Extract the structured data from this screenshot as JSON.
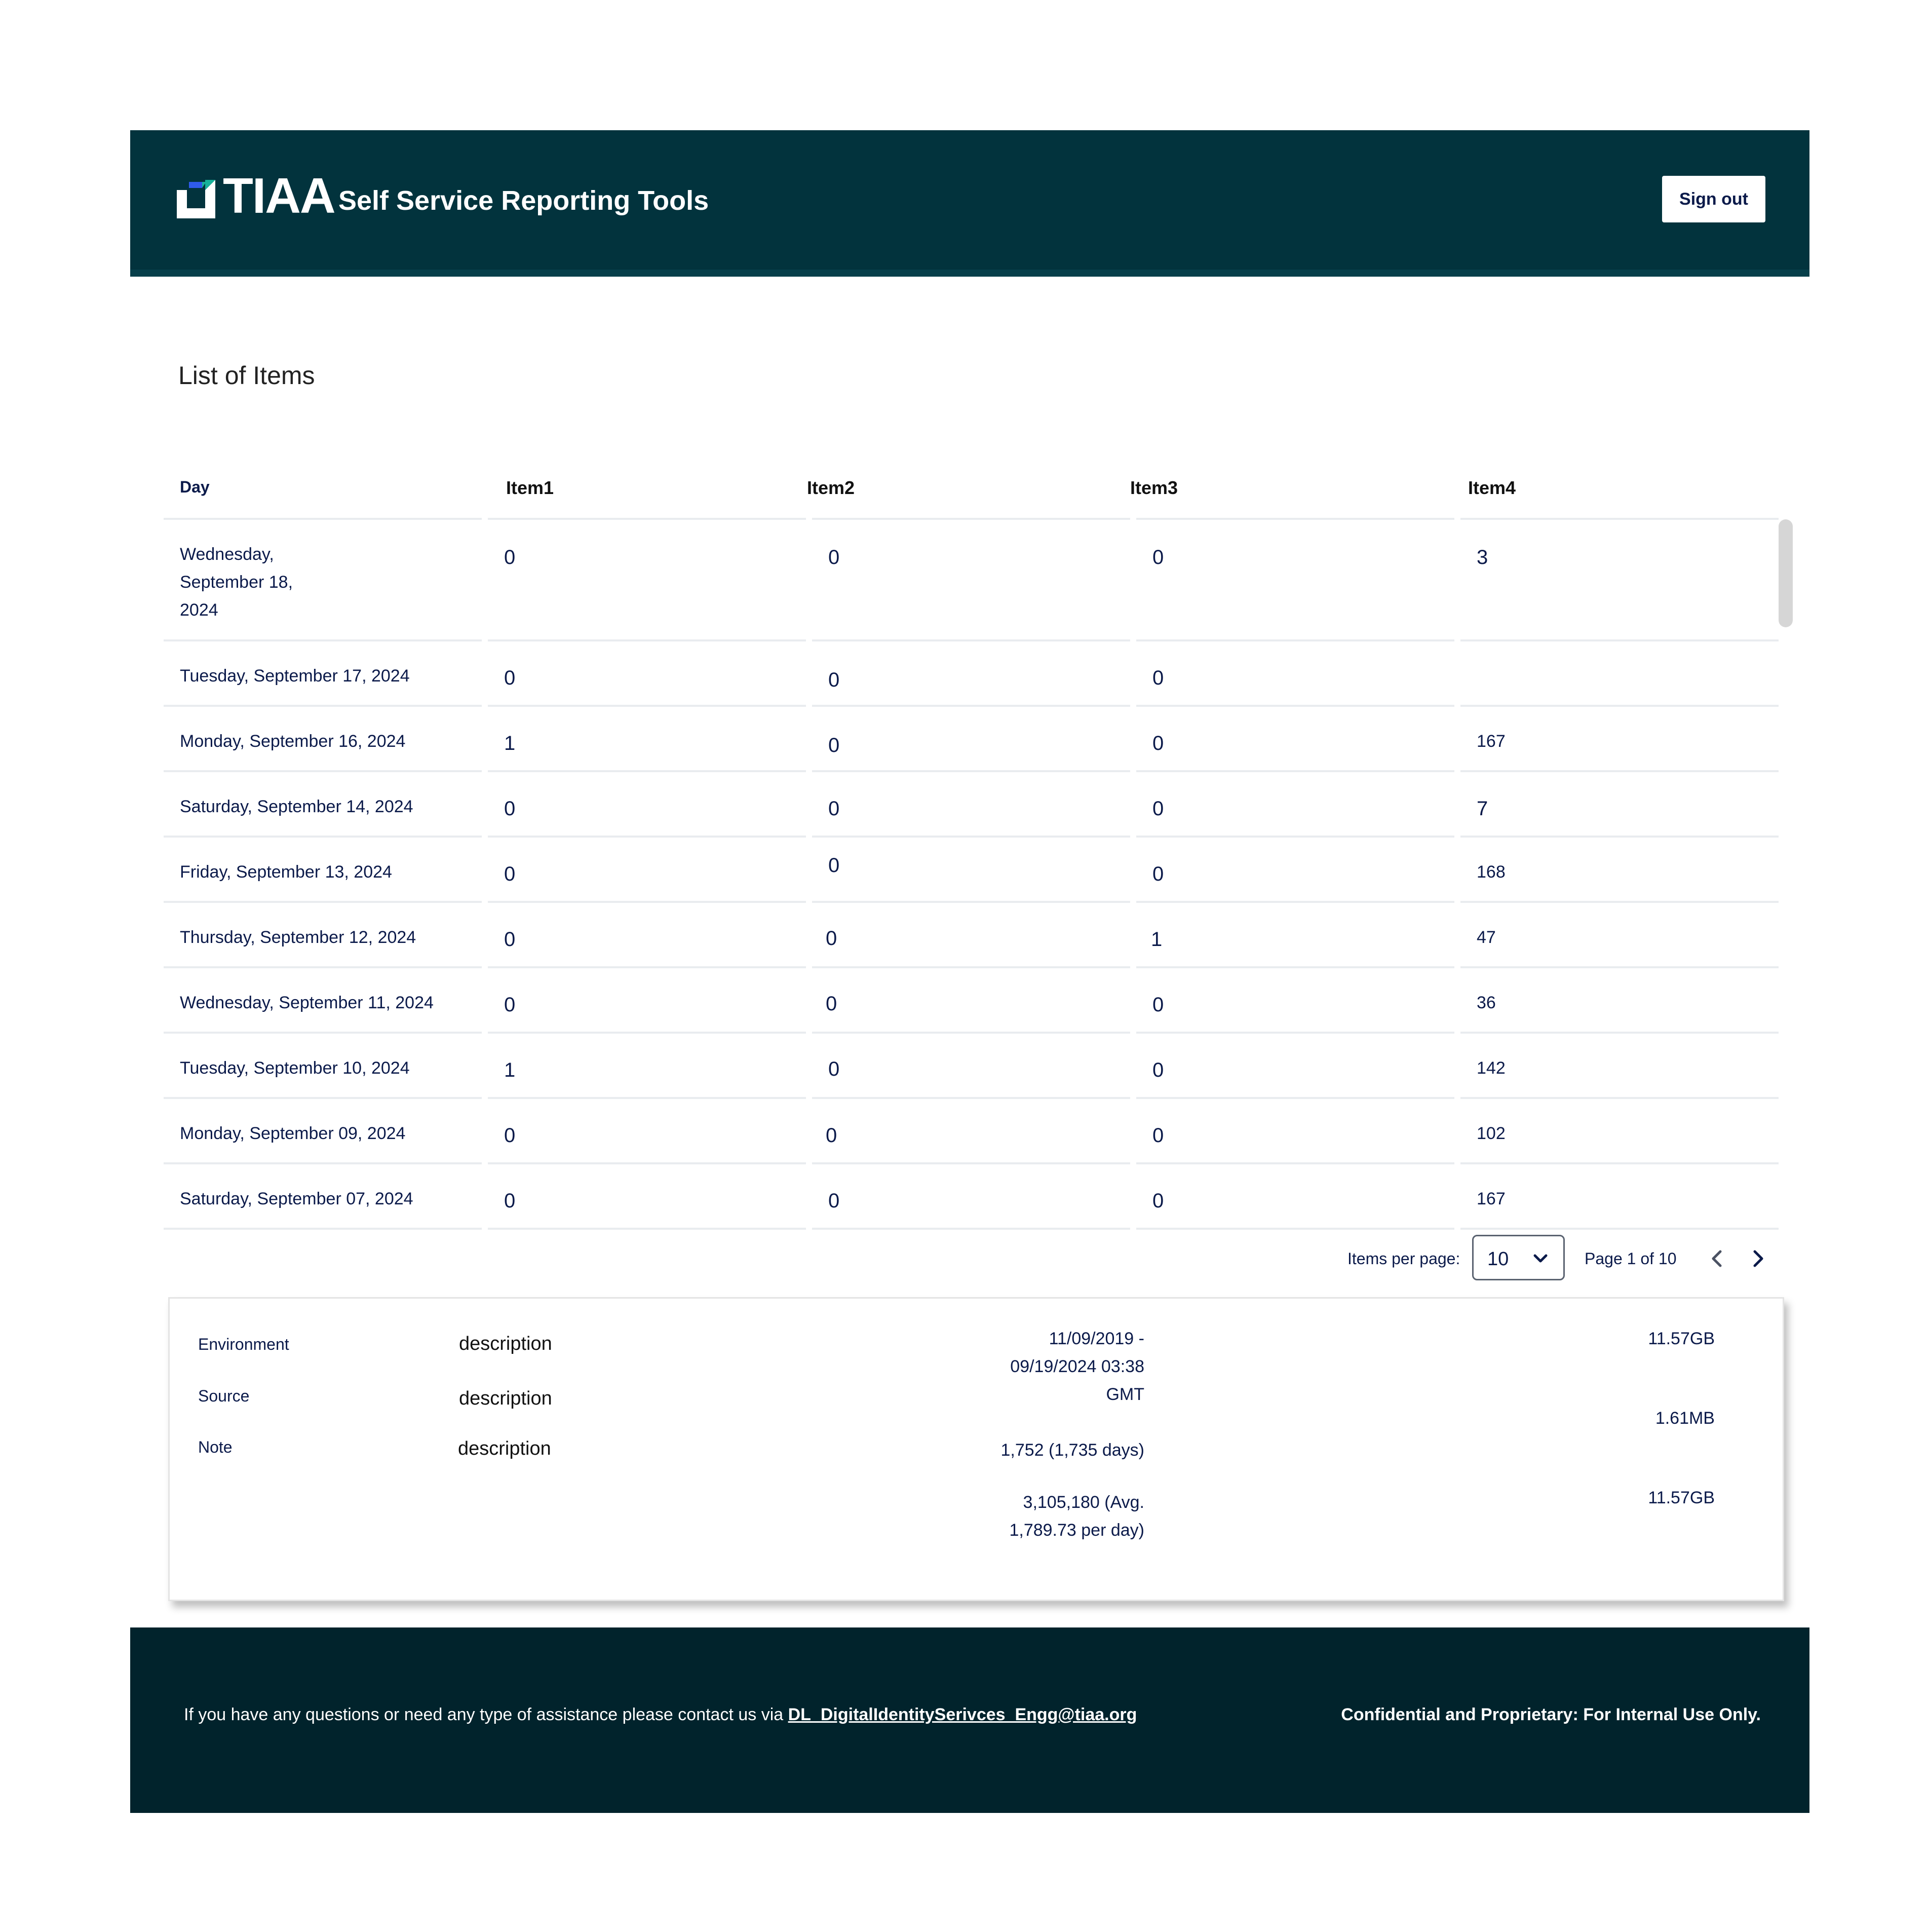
{
  "header": {
    "logo_text": "TIAA",
    "app_title": "Self Service Reporting Tools",
    "sign_out_label": "Sign out"
  },
  "main": {
    "title": "List of Items",
    "table": {
      "columns": [
        "Day",
        "Item1",
        "Item2",
        "Item3",
        "Item4"
      ],
      "rows": [
        {
          "day": "Wednesday, September 18, 2024",
          "item1": "0",
          "item2": "0",
          "item3": "0",
          "item4": "3"
        },
        {
          "day": "Tuesday, September 17, 2024",
          "item1": "0",
          "item2": "0",
          "item3": "0",
          "item4": ""
        },
        {
          "day": "Monday, September 16, 2024",
          "item1": "1",
          "item2": "0",
          "item3": "0",
          "item4": "167"
        },
        {
          "day": "Saturday, September 14, 2024",
          "item1": "0",
          "item2": "0",
          "item3": "0",
          "item4": "7"
        },
        {
          "day": "Friday, September 13, 2024",
          "item1": "0",
          "item2": "0",
          "item3": "0",
          "item4": "168"
        },
        {
          "day": "Thursday, September 12, 2024",
          "item1": "0",
          "item2": "0",
          "item3": "1",
          "item4": "47"
        },
        {
          "day": "Wednesday, September 11, 2024",
          "item1": "0",
          "item2": "0",
          "item3": "0",
          "item4": "36"
        },
        {
          "day": "Tuesday, September 10, 2024",
          "item1": "1",
          "item2": "0",
          "item3": "0",
          "item4": "142"
        },
        {
          "day": "Monday, September 09, 2024",
          "item1": "0",
          "item2": "0",
          "item3": "0",
          "item4": "102"
        },
        {
          "day": "Saturday, September 07, 2024",
          "item1": "0",
          "item2": "0",
          "item3": "0",
          "item4": "167"
        }
      ]
    },
    "pagination": {
      "items_per_page_label": "Items per page:",
      "items_per_page_value": "10",
      "page_status": "Page 1 of 10"
    }
  },
  "info": {
    "labels": [
      "Environment",
      "Source",
      "Note"
    ],
    "descriptions": [
      "description",
      "description",
      "description"
    ],
    "date_range": "11/09/2019 - 09/19/2024 03:38 GMT",
    "days_count": "1,752 (1,735 days)",
    "total_count": "3,105,180 (Avg. 1,789.73 per day)",
    "sizes": [
      "11.57GB",
      "1.61MB",
      "11.57GB"
    ]
  },
  "footer": {
    "contact_text": "If you have any questions or need any type of assistance please contact us via ",
    "contact_email": "DL_DigitalIdentitySerivces_Engg@tiaa.org",
    "confidential": "Confidential and Proprietary: For Internal Use Only."
  },
  "colors": {
    "header_bg": "#02333d",
    "footer_bg": "#01232c",
    "text_navy": "#0b1a4a",
    "logo_blue": "#2f5bea",
    "logo_teal": "#18b29a"
  }
}
